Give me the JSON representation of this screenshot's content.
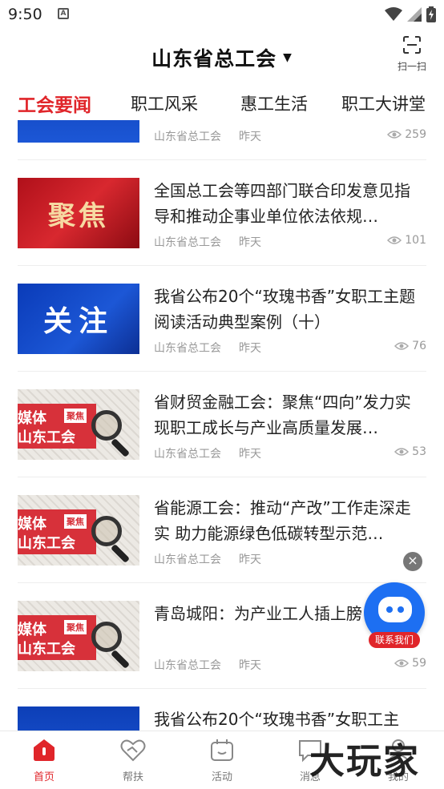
{
  "status_bar": {
    "time": "9:50",
    "notification_letter": "A"
  },
  "header": {
    "title": "山东省总工会",
    "scan_label": "扫一扫"
  },
  "tabs": [
    {
      "label": "工会要闻",
      "active": true
    },
    {
      "label": "职工风采",
      "active": false
    },
    {
      "label": "惠工生活",
      "active": false
    },
    {
      "label": "职工大讲堂",
      "active": false
    }
  ],
  "articles": [
    {
      "title": "",
      "source": "山东省总工会",
      "date": "昨天",
      "views": "259",
      "thumb": "blue-partial"
    },
    {
      "title": "全国总工会等四部门联合印发意见指导和推动企事业单位依法依规…",
      "source": "山东省总工会",
      "date": "昨天",
      "views": "101",
      "thumb": "red",
      "thumb_text": "聚焦"
    },
    {
      "title": "我省公布20个“玫瑰书香”女职工主题阅读活动典型案例（十）",
      "source": "山东省总工会",
      "date": "昨天",
      "views": "76",
      "thumb": "blue",
      "thumb_text": "关注"
    },
    {
      "title": "省财贸金融工会：聚焦“四向”发力实现职工成长与产业高质量发展…",
      "source": "山东省总工会",
      "date": "昨天",
      "views": "53",
      "thumb": "media",
      "thumb_line1": "媒体",
      "thumb_line2": "山东工会",
      "thumb_tag": "聚焦"
    },
    {
      "title": "省能源工会：推动“产改”工作走深走实 助力能源绿色低碳转型示范…",
      "source": "山东省总工会",
      "date": "昨天",
      "views": "",
      "thumb": "media",
      "thumb_line1": "媒体",
      "thumb_line2": "山东工会",
      "thumb_tag": "聚焦"
    },
    {
      "title": "青岛城阳：为产业工人插上膀",
      "source": "山东省总工会",
      "date": "昨天",
      "views": "59",
      "thumb": "media",
      "thumb_line1": "媒体",
      "thumb_line2": "山东工会",
      "thumb_tag": "聚焦"
    },
    {
      "title": "我省公布20个“玫瑰书香”女职工主",
      "source": "",
      "date": "",
      "views": "",
      "thumb": "blue-partial"
    }
  ],
  "float_service": {
    "label": "联系我们",
    "close": "×"
  },
  "bottom_nav": [
    {
      "label": "首页",
      "icon": "home-icon",
      "active": true
    },
    {
      "label": "帮扶",
      "icon": "heart-hand-icon",
      "active": false
    },
    {
      "label": "活动",
      "icon": "calendar-bag-icon",
      "active": false
    },
    {
      "label": "消息",
      "icon": "message-icon",
      "active": false
    },
    {
      "label": "我的",
      "icon": "profile-icon",
      "active": false
    }
  ],
  "watermark": "大玩家",
  "colors": {
    "accent": "#e0252a",
    "robot": "#1d6ff2",
    "muted": "#999999"
  }
}
